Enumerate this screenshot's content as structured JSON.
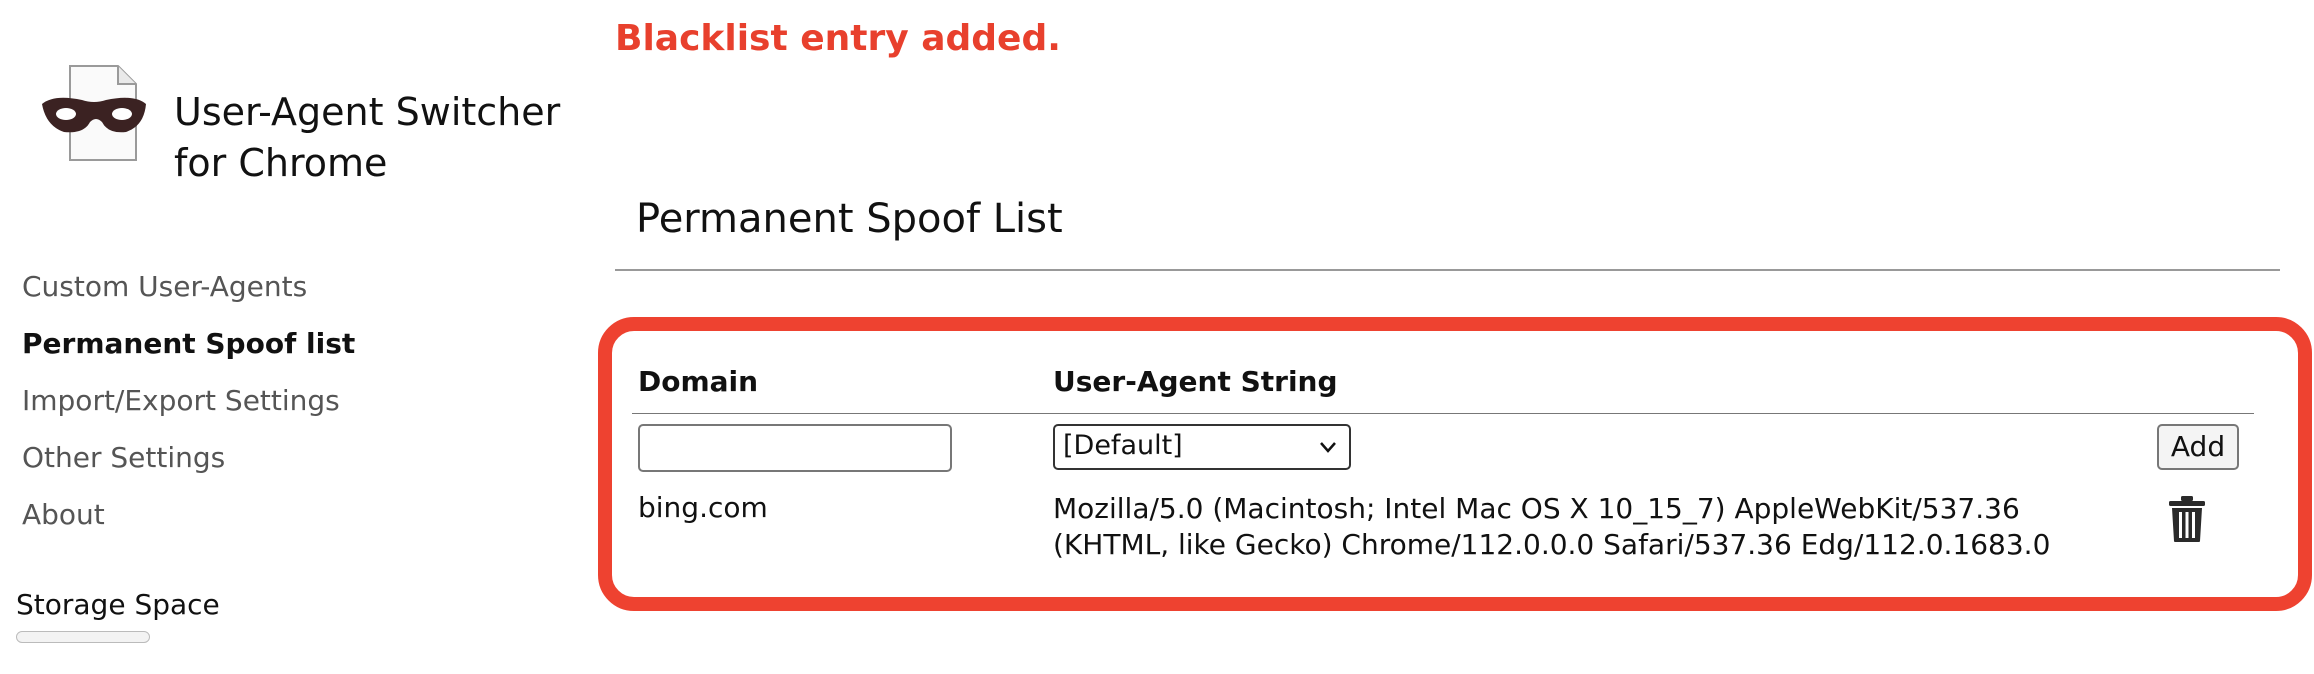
{
  "alert": {
    "message": "Blacklist entry added.",
    "color": "#e8402d"
  },
  "app": {
    "title": "User-Agent Switcher for Chrome",
    "logo_icon": "masked-document-icon"
  },
  "nav": {
    "items": [
      {
        "label": "Custom User-Agents",
        "active": false
      },
      {
        "label": "Permanent Spoof list",
        "active": true
      },
      {
        "label": "Import/Export Settings",
        "active": false
      },
      {
        "label": "Other Settings",
        "active": false
      },
      {
        "label": "About",
        "active": false
      }
    ]
  },
  "storage": {
    "label": "Storage Space",
    "used_fraction": 0.0
  },
  "section": {
    "title": "Permanent Spoof List"
  },
  "table": {
    "headers": {
      "domain": "Domain",
      "ua": "User-Agent String"
    },
    "new_entry": {
      "domain_value": "",
      "ua_selected": "[Default]",
      "add_label": "Add"
    },
    "rows": [
      {
        "domain": "bing.com",
        "ua": "Mozilla/5.0 (Macintosh; Intel Mac OS X 10_15_7) AppleWebKit/537.36 (KHTML, like Gecko) Chrome/112.0.0.0 Safari/537.36 Edg/112.0.1683.0",
        "delete_icon": "trash-icon"
      }
    ]
  },
  "colors": {
    "highlight_border": "#ee4230",
    "alert_text": "#e8402d"
  }
}
